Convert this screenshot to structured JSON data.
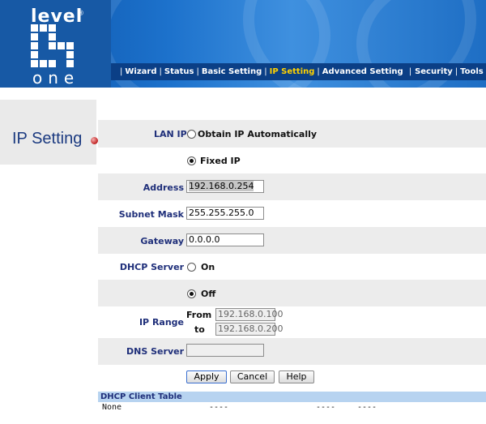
{
  "logo": {
    "top": "level",
    "bottom": "one",
    "reg": "®"
  },
  "nav": {
    "items": [
      {
        "label": "Wizard"
      },
      {
        "label": "Status"
      },
      {
        "label": "Basic Setting"
      },
      {
        "label": "IP Setting",
        "active": true
      },
      {
        "label": "Advanced Setting"
      },
      {
        "label": "Security"
      },
      {
        "label": "Tools"
      }
    ],
    "separator": "|"
  },
  "page": {
    "title": "IP Setting"
  },
  "form": {
    "lan_ip_label": "LAN IP",
    "obtain_auto_label": "Obtain IP Automatically",
    "fixed_ip_label": "Fixed IP",
    "address_label": "Address",
    "address_value": "192.168.0.254",
    "subnet_label": "Subnet Mask",
    "subnet_value": "255.255.255.0",
    "gateway_label": "Gateway",
    "gateway_value": "0.0.0.0",
    "dhcp_label": "DHCP Server",
    "dhcp_on_label": "On",
    "dhcp_off_label": "Off",
    "ip_range_label": "IP Range",
    "from_label": "From",
    "to_label": "to",
    "range_from_value": "192.168.0.100",
    "range_to_value": "192.168.0.200",
    "dns_label": "DNS Server",
    "dns_value": "",
    "lan_mode": "fixed",
    "dhcp_mode": "off"
  },
  "buttons": {
    "apply": "Apply",
    "cancel": "Cancel",
    "help": "Help"
  },
  "dhcp_table": {
    "title": "DHCP Client Table",
    "row": [
      "None",
      "----",
      "----",
      "----"
    ]
  },
  "colors": {
    "accent": "#1f2f7a",
    "nav_active": "#ffd200",
    "header": "#1759a5"
  }
}
